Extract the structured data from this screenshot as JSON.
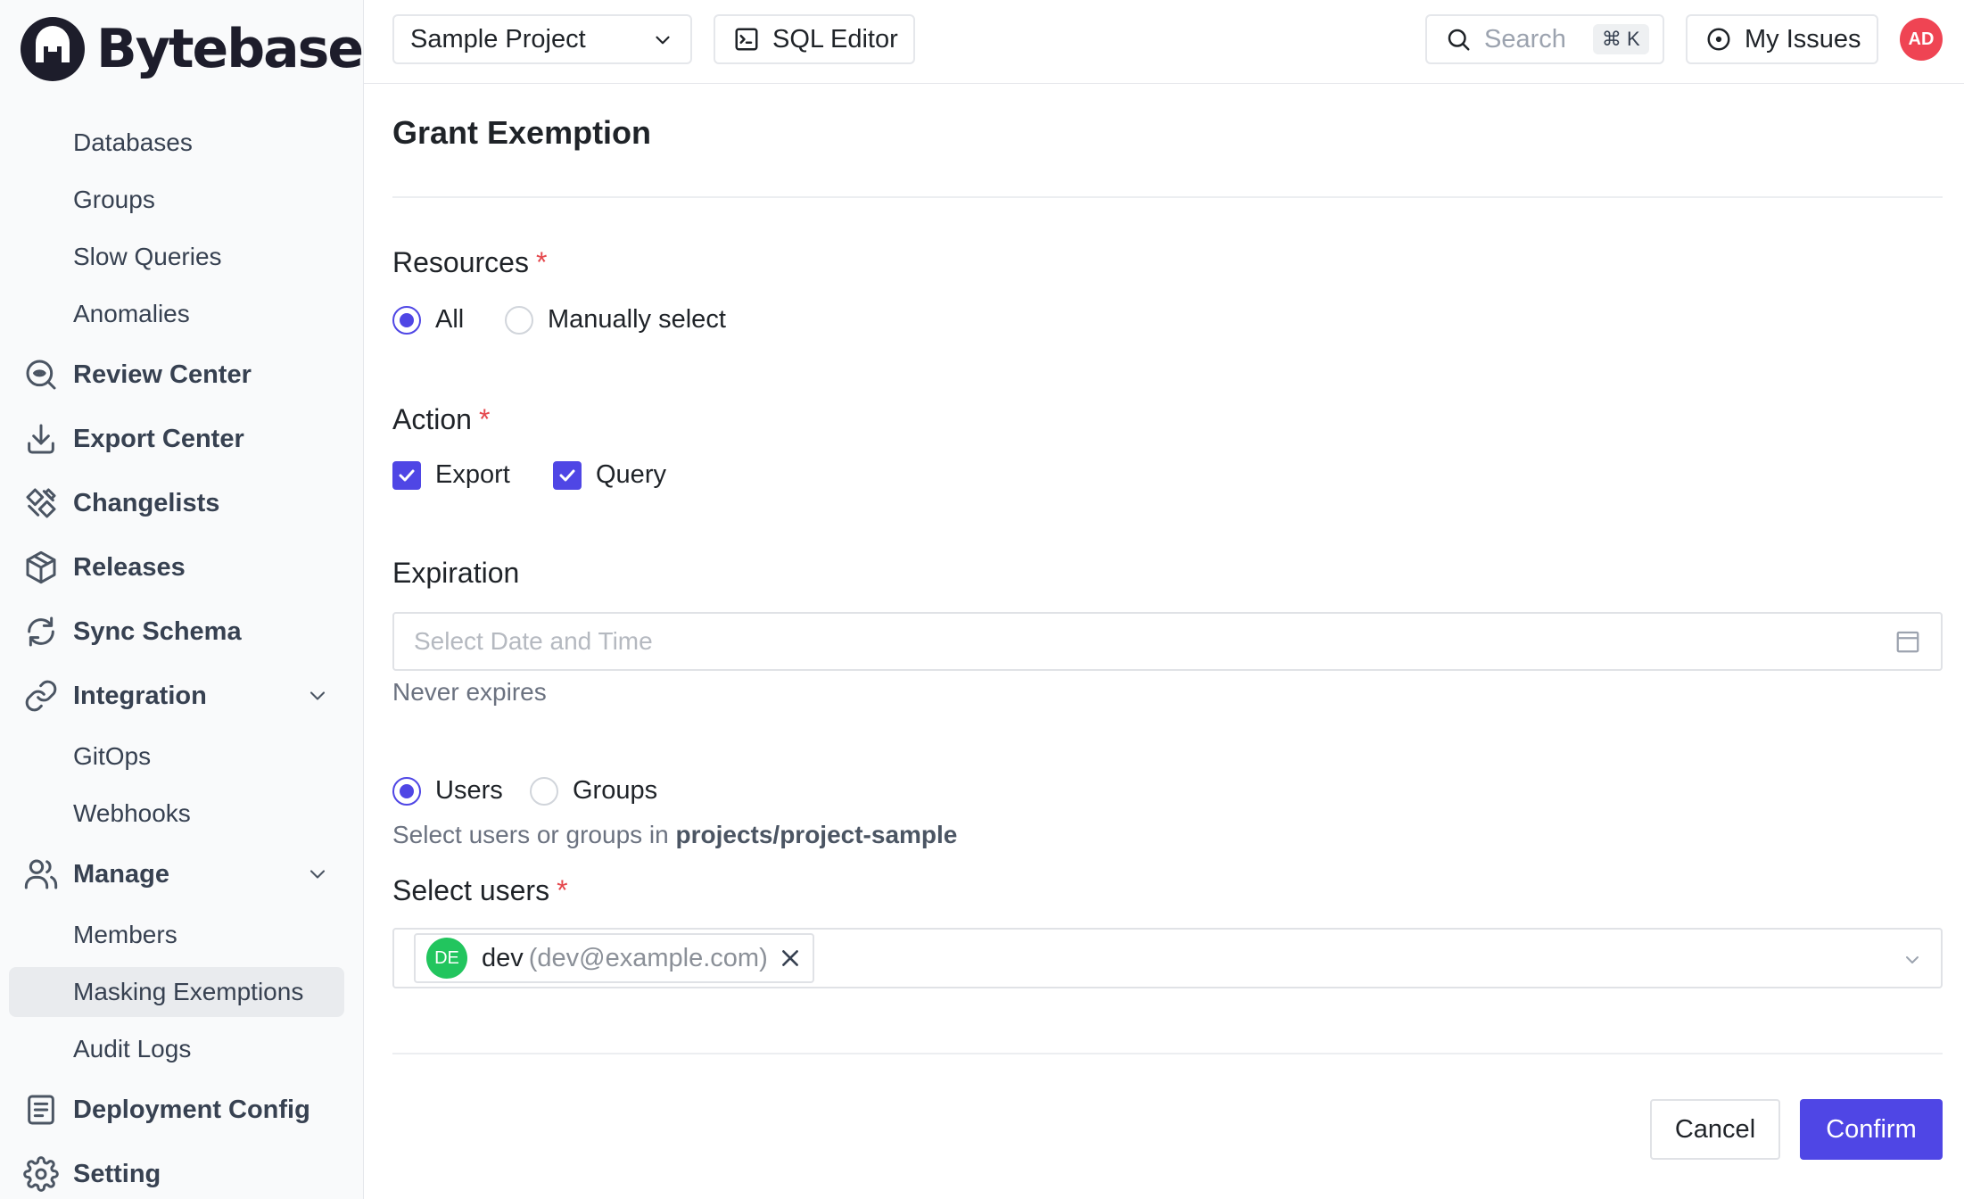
{
  "app": {
    "name": "Bytebase"
  },
  "sidebar": {
    "items": [
      {
        "label": "Databases",
        "kind": "sub"
      },
      {
        "label": "Groups",
        "kind": "sub"
      },
      {
        "label": "Slow Queries",
        "kind": "sub"
      },
      {
        "label": "Anomalies",
        "kind": "sub"
      },
      {
        "label": "Review Center",
        "kind": "top",
        "icon": "review-center-icon"
      },
      {
        "label": "Export Center",
        "kind": "top",
        "icon": "download-icon"
      },
      {
        "label": "Changelists",
        "kind": "top",
        "icon": "changelists-icon"
      },
      {
        "label": "Releases",
        "kind": "top",
        "icon": "package-icon"
      },
      {
        "label": "Sync Schema",
        "kind": "top",
        "icon": "sync-icon"
      },
      {
        "label": "Integration",
        "kind": "top",
        "icon": "link-icon",
        "expanded": true
      },
      {
        "label": "GitOps",
        "kind": "sub"
      },
      {
        "label": "Webhooks",
        "kind": "sub"
      },
      {
        "label": "Manage",
        "kind": "top",
        "icon": "users-icon",
        "expanded": true
      },
      {
        "label": "Members",
        "kind": "sub"
      },
      {
        "label": "Masking Exemptions",
        "kind": "sub",
        "active": true
      },
      {
        "label": "Audit Logs",
        "kind": "sub"
      },
      {
        "label": "Deployment Config",
        "kind": "top",
        "icon": "document-icon"
      },
      {
        "label": "Setting",
        "kind": "top",
        "icon": "gear-icon"
      }
    ]
  },
  "header": {
    "project_select": "Sample Project",
    "sql_editor": "SQL Editor",
    "search_placeholder": "Search",
    "search_shortcut": "⌘ K",
    "my_issues": "My Issues",
    "avatar_initials": "AD"
  },
  "form": {
    "title": "Grant Exemption",
    "resources": {
      "label": "Resources",
      "required": "*",
      "options": [
        {
          "label": "All",
          "selected": true
        },
        {
          "label": "Manually select",
          "selected": false
        }
      ]
    },
    "action": {
      "label": "Action",
      "required": "*",
      "options": [
        {
          "label": "Export",
          "checked": true
        },
        {
          "label": "Query",
          "checked": true
        }
      ]
    },
    "expiration": {
      "label": "Expiration",
      "placeholder": "Select Date and Time",
      "hint": "Never expires"
    },
    "principal": {
      "options": [
        {
          "label": "Users",
          "selected": true
        },
        {
          "label": "Groups",
          "selected": false
        }
      ],
      "hint_prefix": "Select users or groups in",
      "hint_project": "projects/project-sample"
    },
    "select_users": {
      "label": "Select users",
      "required": "*",
      "selected": [
        {
          "initials": "DE",
          "name": "dev",
          "email": "(dev@example.com)"
        }
      ]
    },
    "buttons": {
      "cancel": "Cancel",
      "confirm": "Confirm"
    }
  },
  "colors": {
    "accent": "#4f46e5",
    "required": "#e5484d",
    "avatar_top": "#ef4453",
    "avatar_user": "#22c55e"
  }
}
